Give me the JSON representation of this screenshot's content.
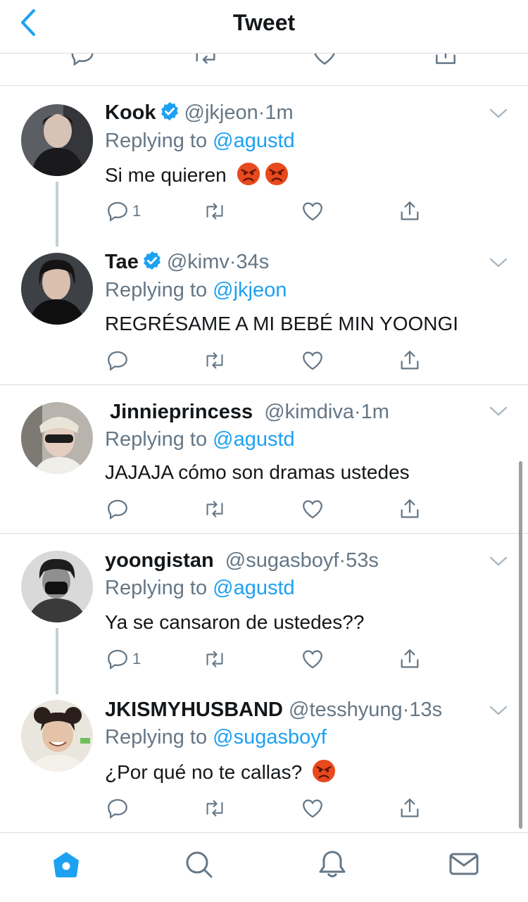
{
  "header": {
    "title": "Tweet",
    "back_icon": "chevron-left-icon"
  },
  "colors": {
    "accent": "#1da1f2",
    "secondary_text": "#657786",
    "primary_text": "#14171a",
    "angry_emoji": "#e8491d"
  },
  "tweets": [
    {
      "display_name": "Kook",
      "verified": true,
      "handle": "@jkjeon",
      "dot": "·",
      "time": "1m",
      "replying_prefix": "Replying to",
      "replying_to": "@agustd",
      "text": "Si me quieren",
      "emojis": [
        "angry-face-emoji",
        "angry-face-emoji"
      ],
      "reply_count": "1"
    },
    {
      "display_name": "Tae",
      "verified": true,
      "handle": "@kimv",
      "dot": "·",
      "time": "34s",
      "replying_prefix": "Replying to",
      "replying_to": "@jkjeon",
      "text": "REGRÉSAME A MI BEBÉ MIN YOONGI",
      "emojis": [],
      "reply_count": ""
    },
    {
      "display_name": "Jinnieprincess",
      "verified": false,
      "handle": "@kimdiva",
      "dot": "·",
      "time": "1m",
      "replying_prefix": "Replying to",
      "replying_to": "@agustd",
      "text": "JAJAJA cómo son dramas ustedes",
      "emojis": [],
      "reply_count": ""
    },
    {
      "display_name": "yoongistan",
      "verified": false,
      "handle": "@sugasboyf",
      "dot": "·",
      "time": "53s",
      "replying_prefix": "Replying to",
      "replying_to": "@agustd",
      "text": "Ya se cansaron de ustedes??",
      "emojis": [],
      "reply_count": "1"
    },
    {
      "display_name": "JKISMYHUSBAND",
      "verified": false,
      "handle": "@tesshyung",
      "dot": "·",
      "time": "13s",
      "replying_prefix": "Replying to",
      "replying_to": "@sugasboyf",
      "text": "¿Por qué no te callas?",
      "emojis": [
        "angry-face-emoji"
      ],
      "reply_count": ""
    }
  ],
  "tabbar": {
    "items": [
      "home-icon",
      "search-icon",
      "notifications-icon",
      "messages-icon"
    ],
    "active": "home-icon"
  }
}
